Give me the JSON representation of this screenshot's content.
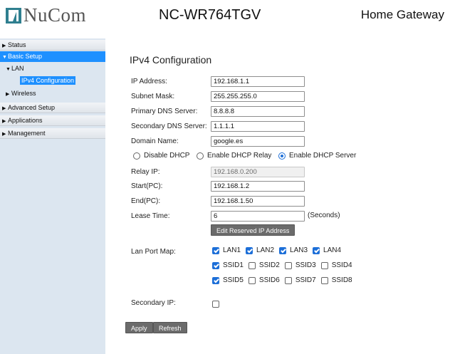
{
  "header": {
    "logo_text": "NuCom",
    "model": "NC-WR764TGV",
    "product": "Home Gateway"
  },
  "sidebar": {
    "status": "Status",
    "basic_setup": "Basic Setup",
    "lan": "LAN",
    "ipv4_config": "IPv4 Configuration",
    "wireless": "Wireless",
    "advanced_setup": "Advanced Setup",
    "applications": "Applications",
    "management": "Management"
  },
  "page": {
    "title": "IPv4 Configuration",
    "ip_label": "IP Address:",
    "ip_value": "192.168.1.1",
    "mask_label": "Subnet Mask:",
    "mask_value": "255.255.255.0",
    "pdns_label": "Primary DNS Server:",
    "pdns_value": "8.8.8.8",
    "sdns_label": "Secondary DNS Server:",
    "sdns_value": "1.1.1.1",
    "domain_label": "Domain Name:",
    "domain_value": "google.es",
    "dhcp_options": {
      "disable": "Disable DHCP",
      "relay": "Enable DHCP Relay",
      "server": "Enable DHCP Server",
      "selected": "server"
    },
    "relay_label": "Relay IP:",
    "relay_value": "192.168.0.200",
    "start_label": "Start(PC):",
    "start_value": "192.168.1.2",
    "end_label": "End(PC):",
    "end_value": "192.168.1.50",
    "lease_label": "Lease Time:",
    "lease_value": "6",
    "lease_unit": "(Seconds)",
    "edit_reserved_button": "Edit Reserved IP Address",
    "lan_port_map_label": "Lan Port Map:",
    "ports": {
      "lan1": "LAN1",
      "lan2": "LAN2",
      "lan3": "LAN3",
      "lan4": "LAN4",
      "ssid1": "SSID1",
      "ssid2": "SSID2",
      "ssid3": "SSID3",
      "ssid4": "SSID4",
      "ssid5": "SSID5",
      "ssid6": "SSID6",
      "ssid7": "SSID7",
      "ssid8": "SSID8"
    },
    "secondary_ip_label": "Secondary IP:",
    "apply_button": "Apply",
    "refresh_button": "Refresh"
  },
  "colors": {
    "sidebar_bg": "#dce6f0",
    "accent": "#1e90ff",
    "button_bg": "#6b6b6b",
    "checkbox_on": "#1d6fd8"
  }
}
